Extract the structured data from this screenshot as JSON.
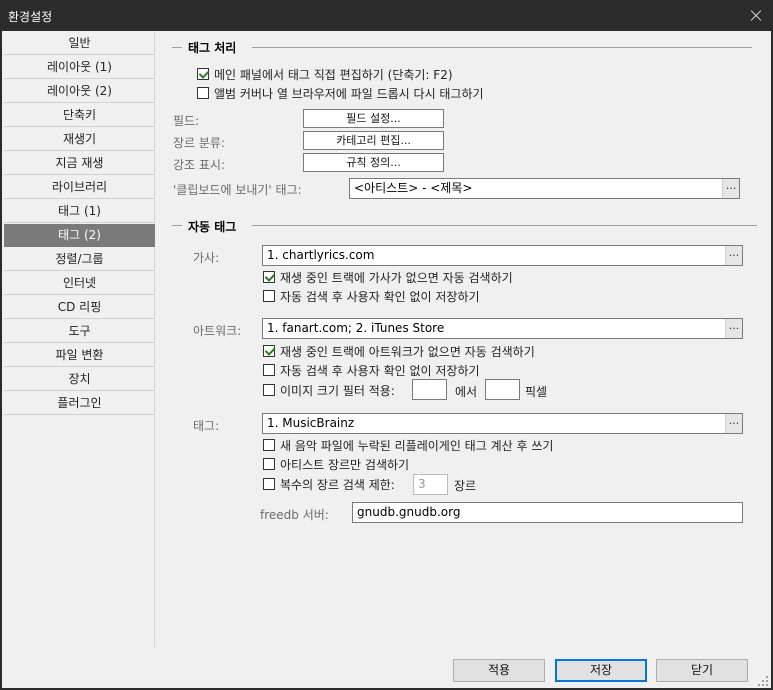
{
  "window": {
    "title": "환경설정"
  },
  "sidebar": {
    "selected": "태그 (2)",
    "items": [
      "일반",
      "레이아웃 (1)",
      "레이아웃 (2)",
      "단축키",
      "재생기",
      "지금 재생",
      "라이브러리",
      "태그 (1)",
      "태그 (2)",
      "정렬/그룹",
      "인터넷",
      "CD 리핑",
      "도구",
      "파일 변환",
      "장치",
      "플러그인"
    ]
  },
  "tag_processing": {
    "title": "태그 처리",
    "inline_edit": {
      "label": "메인 패널에서 태그 직접 편집하기 (단축기: F2)",
      "checked": true
    },
    "retag_drop": {
      "label": "앨범 커버나 열 브라우저에 파일 드롭시 다시 태그하기",
      "checked": false
    },
    "fields_label": "필드:",
    "fields_button": "필드 설정...",
    "genre_label": "장르 분류:",
    "genre_button": "카테고리 편집...",
    "highlight_label": "강조 표시:",
    "highlight_button": "규칙 정의...",
    "clipboard_label": "'클립보드에 보내기' 태그:",
    "clipboard_value": "<아티스트> - <제목>",
    "ellipsis": "..."
  },
  "auto_tag": {
    "title": "자동 태그",
    "lyrics": {
      "label": "가사:",
      "value": "1. chartlyrics.com",
      "auto_search": {
        "label": "재생 중인 트랙에 가사가 없으면 자동 검색하기",
        "checked": true
      },
      "auto_save": {
        "label": "자동 검색 후 사용자 확인 없이 저장하기",
        "checked": false
      }
    },
    "artwork": {
      "label": "아트워크:",
      "value": "1. fanart.com; 2. iTunes Store",
      "auto_search": {
        "label": "재생 중인 트랙에 아트워크가 없으면 자동 검색하기",
        "checked": true
      },
      "auto_save": {
        "label": "자동 검색 후 사용자 확인 없이 저장하기",
        "checked": false
      },
      "size_filter": {
        "label": "이미지 크기 필터 적용:",
        "checked": false,
        "from_value": "",
        "between": "에서",
        "to_value": "",
        "unit": "픽셀"
      }
    },
    "tags": {
      "label": "태그:",
      "value": "1. MusicBrainz",
      "replaygain": {
        "label": "새 음악 파일에 누락된 리플레이게인 태그 계산 후 쓰기",
        "checked": false
      },
      "artist_genre": {
        "label": "아티스트 장르만 검색하기",
        "checked": false
      },
      "limit_genres": {
        "label": "복수의 장르 검색 제한:",
        "checked": false,
        "value": "3",
        "unit": "장르"
      }
    },
    "freedb": {
      "label": "freedb 서버:",
      "value": "gnudb.gnudb.org"
    }
  },
  "buttons": {
    "apply": "적용",
    "save": "저장",
    "close": "닫기"
  }
}
